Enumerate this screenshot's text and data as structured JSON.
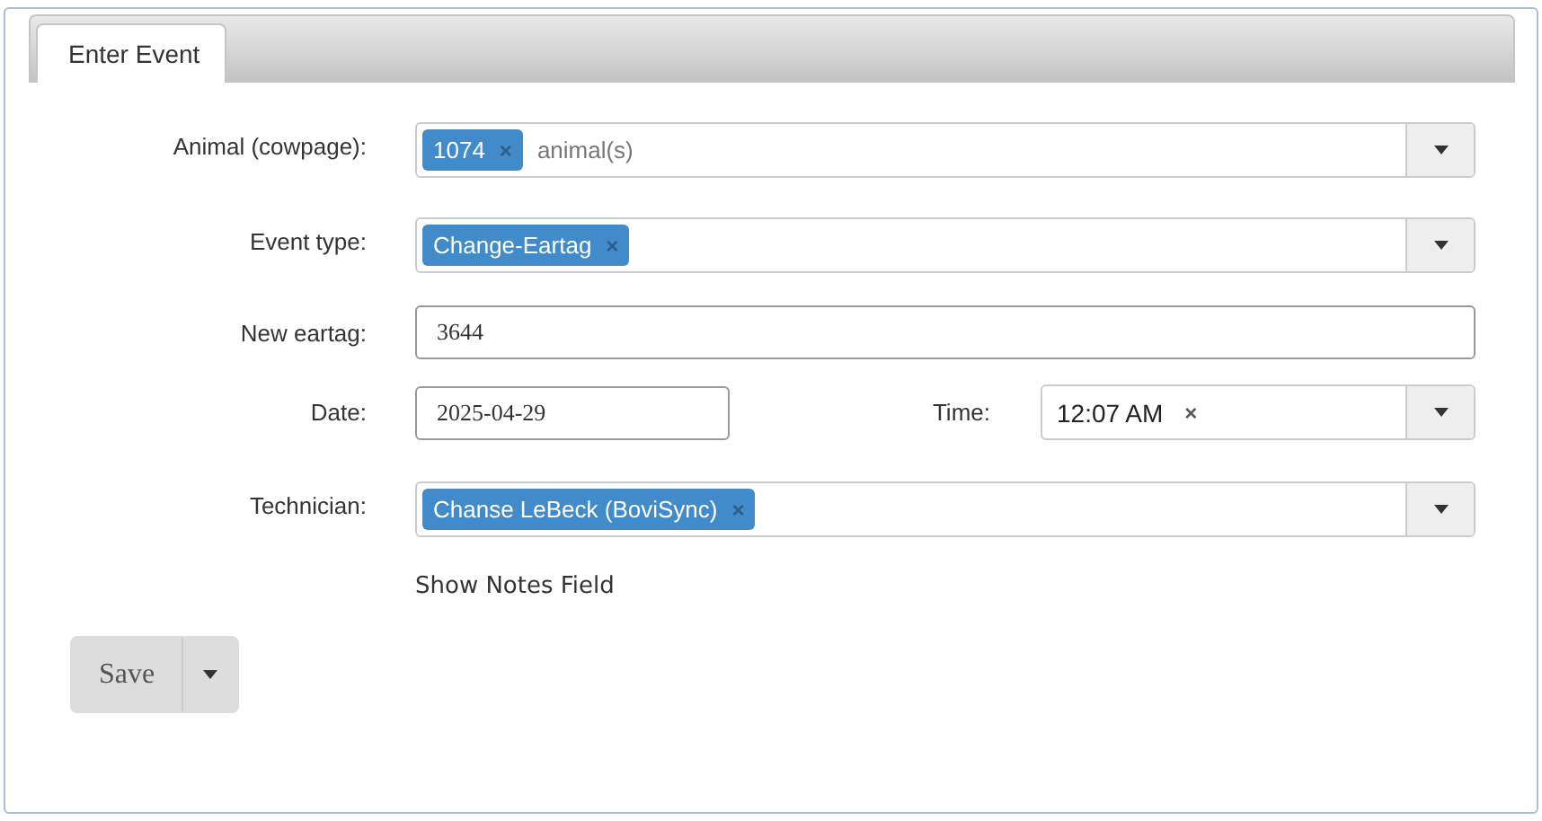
{
  "tabs": [
    {
      "label": "Enter Event",
      "selected": true
    }
  ],
  "fields": [
    {
      "kind": "tags",
      "label": "Animal (cowpage):",
      "tags": [
        {
          "text": "1074",
          "remove": "×"
        }
      ],
      "placeholder": "animal(s)"
    },
    {
      "kind": "tags",
      "label": "Event type:",
      "tags": [
        {
          "text": "Change-Eartag",
          "remove": "×"
        }
      ]
    },
    {
      "kind": "text",
      "label": "New eartag:",
      "value": "3644"
    },
    {
      "kind": "datetime",
      "label": "Date:",
      "value": "2025-04-29",
      "time_label": "Time:",
      "time_value": "12:07 AM",
      "time_clear": "×"
    },
    {
      "kind": "tags",
      "label": "Technician:",
      "tags": [
        {
          "text": "Chanse LeBeck (BoviSync)",
          "remove": "×"
        }
      ]
    }
  ],
  "notes_link": "Show Notes Field",
  "save_button": {
    "label": "Save"
  }
}
